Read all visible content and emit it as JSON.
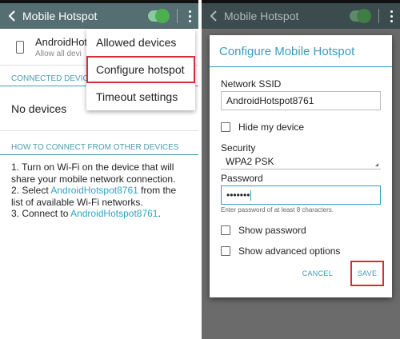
{
  "left": {
    "appbar": {
      "title": "Mobile Hotspot",
      "back_icon": "chevron-left-icon",
      "toggle_state": "on",
      "more_icon": "more-vert-icon"
    },
    "device": {
      "name": "AndroidHot",
      "subtitle": "Allow all devi"
    },
    "connected_header": "CONNECTED DEVICE",
    "no_devices": "No devices",
    "howto_header": "HOW TO CONNECT FROM OTHER DEVICES",
    "steps": {
      "s1": "1. Turn on Wi-Fi on the device that will share your mobile network connection.",
      "s2_pre": "2. Select ",
      "s2_link": "AndroidHotspot8761",
      "s2_post": " from the list of available Wi-Fi networks.",
      "s3_pre": "3. Connect to ",
      "s3_link": "AndroidHotspot8761",
      "s3_post": "."
    },
    "menu": {
      "items": [
        "Allowed devices",
        "Configure hotspot",
        "Timeout settings"
      ],
      "highlighted_index": 1
    }
  },
  "right": {
    "appbar": {
      "title": "Mobile Hotspot",
      "peek": "AndroidHotspot8761"
    },
    "dialog": {
      "title": "Configure Mobile Hotspot",
      "ssid_label": "Network SSID",
      "ssid_value": "AndroidHotspot8761",
      "hide_label": "Hide my device",
      "security_label": "Security",
      "security_value": "WPA2 PSK",
      "password_label": "Password",
      "password_value": "•••••••",
      "password_hint": "Enter password of at least 8 characters.",
      "show_password_label": "Show password",
      "advanced_label": "Show advanced options",
      "cancel_label": "CANCEL",
      "save_label": "SAVE"
    }
  },
  "colors": {
    "appbar": "#546e72",
    "accent": "#3a9bbf",
    "highlight_border": "#d32f3a",
    "toggle": "#4caf50"
  }
}
